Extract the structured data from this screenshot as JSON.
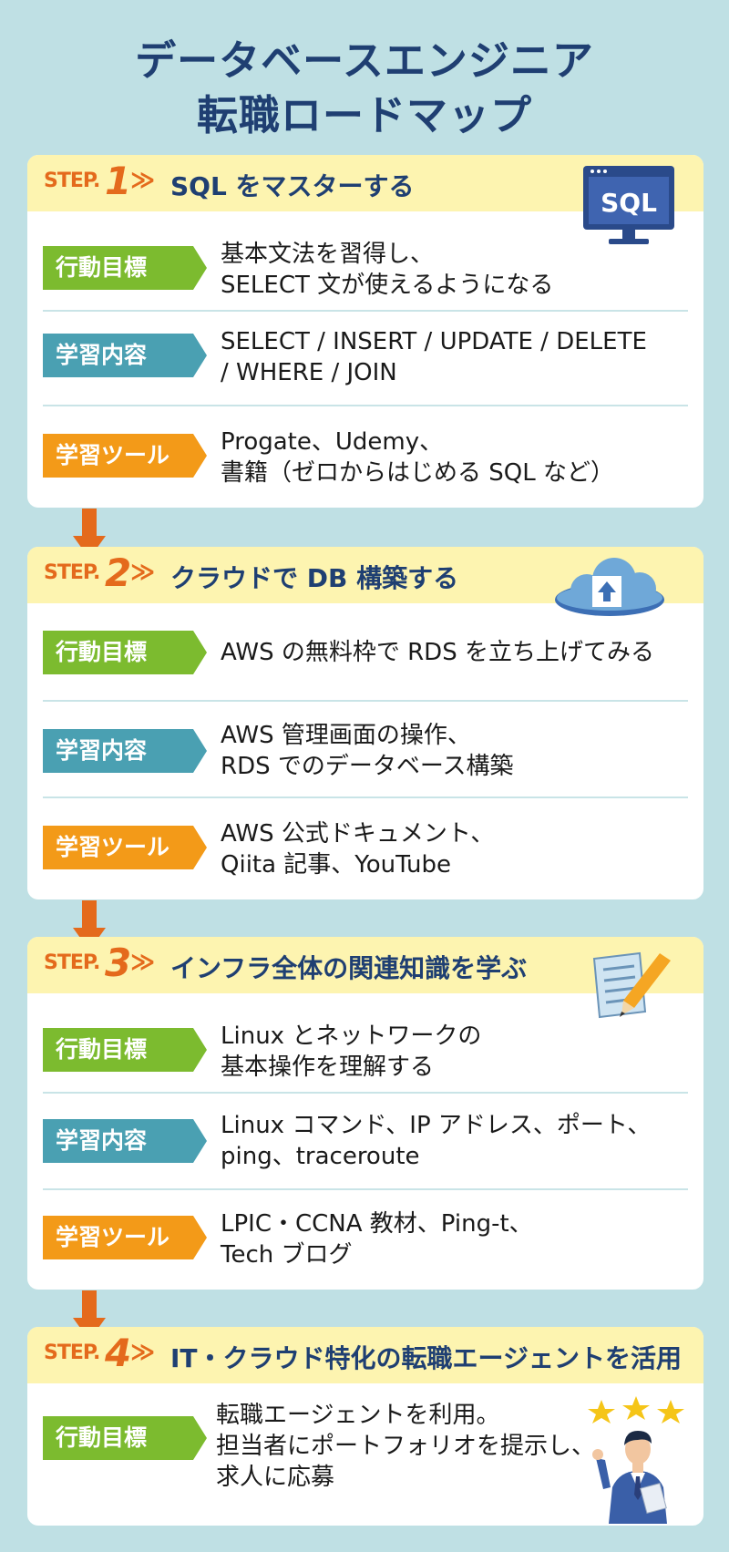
{
  "title": {
    "line1": "データベースエンジニア",
    "line2": "転職ロードマップ"
  },
  "step_label": "STEP.",
  "chevron": "≫",
  "colors": {
    "accent": "#e46a1c",
    "navy": "#1f3f72",
    "green": "#7cbb2f",
    "blue": "#4aa0b2",
    "orange": "#f39a18",
    "header_yellow": "#fdf4b0"
  },
  "steps": [
    {
      "num": "1",
      "title": "SQL をマスターする",
      "icon": "sql-monitor-icon",
      "icon_text": "SQL",
      "goal_label": "行動目標",
      "goal": [
        "基本文法を習得し、",
        "SELECT 文が使えるようになる"
      ],
      "content_label": "学習内容",
      "content": [
        "SELECT / INSERT / UPDATE / DELETE",
        "/ WHERE / JOIN"
      ],
      "tool_label": "学習ツール",
      "tools": [
        "Progate、Udemy、",
        "書籍（ゼロからはじめる SQL など）"
      ]
    },
    {
      "num": "2",
      "title": "クラウドで DB 構築する",
      "icon": "cloud-upload-icon",
      "goal_label": "行動目標",
      "goal": [
        "AWS の無料枠で RDS を立ち上げてみる"
      ],
      "content_label": "学習内容",
      "content": [
        "AWS 管理画面の操作、",
        "RDS でのデータベース構築"
      ],
      "tool_label": "学習ツール",
      "tools": [
        "AWS 公式ドキュメント、",
        "Qiita 記事、YouTube"
      ]
    },
    {
      "num": "3",
      "title": "インフラ全体の関連知識を学ぶ",
      "icon": "document-pencil-icon",
      "goal_label": "行動目標",
      "goal": [
        "Linux とネットワークの",
        "基本操作を理解する"
      ],
      "content_label": "学習内容",
      "content": [
        "Linux コマンド、IP アドレス、ポート、",
        "ping、traceroute"
      ],
      "tool_label": "学習ツール",
      "tools": [
        "LPIC・CCNA 教材、Ping-t、",
        "Tech ブログ"
      ]
    },
    {
      "num": "4",
      "title": "IT・クラウド特化の転職エージェントを活用",
      "icon": "agent-person-stars-icon",
      "goal_label": "行動目標",
      "goal": [
        "転職エージェントを利用。",
        "担当者にポートフォリオを提示し、",
        "求人に応募"
      ]
    }
  ]
}
